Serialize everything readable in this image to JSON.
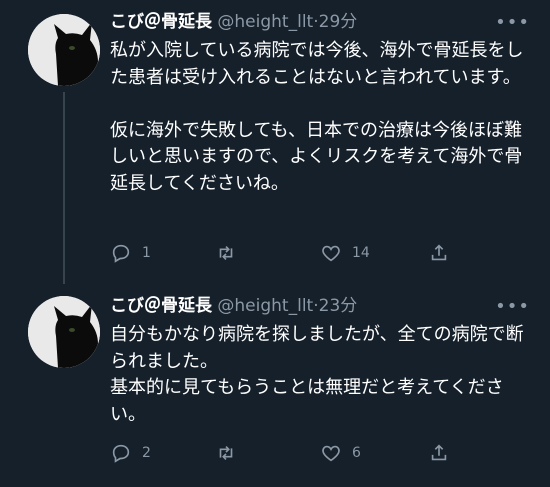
{
  "tweets": [
    {
      "name": "こび＠骨延長",
      "handle": "@height_llt",
      "separator": "·",
      "time": "29分",
      "more": "•••",
      "text": "私が入院している病院では今後、海外で骨延長をした患者は受け入れることはないと言われています。\n\n仮に海外で失敗しても、日本での治療は今後ほぼ難しいと思いますので、よくリスクを考えて海外で骨延長してくださいね。",
      "replies": "1",
      "retweets": "",
      "likes": "14"
    },
    {
      "name": "こび＠骨延長",
      "handle": "@height_llt",
      "separator": "·",
      "time": "23分",
      "more": "•••",
      "text": "自分もかなり病院を探しましたが、全ての病院で断られました。\n基本的に見てもらうことは無理だと考えてください。",
      "replies": "2",
      "retweets": "",
      "likes": "6"
    }
  ],
  "icons": {
    "reply": "reply-icon",
    "retweet": "retweet-icon",
    "like": "heart-icon",
    "share": "share-icon",
    "more": "more-icon"
  },
  "colors": {
    "background": "#15202b",
    "secondary_text": "#8b98a5",
    "thread_line": "#38444d"
  }
}
